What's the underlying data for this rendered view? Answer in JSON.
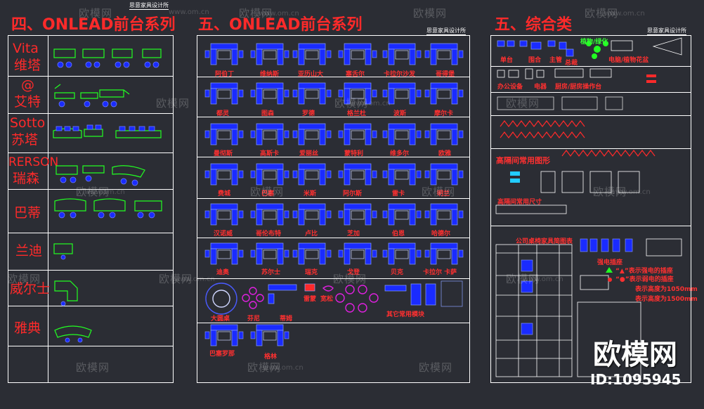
{
  "section_titles": {
    "left": "四、ONLEAD前台系列",
    "middle": "五、ONLEAD前台系列",
    "right": "五、综合类"
  },
  "stamps": {
    "left": "思意家具设计所",
    "middle": "思意家具设计所",
    "right": "思意家具设计所"
  },
  "left_rows": [
    {
      "line1": "Vita",
      "line2": "维塔"
    },
    {
      "line1": "@",
      "line2": "艾特"
    },
    {
      "line1": "Sotto",
      "line2": "苏塔"
    },
    {
      "line1": "RERSON",
      "line2": "瑞森"
    },
    {
      "line1": "",
      "line2": "巴蒂"
    },
    {
      "line1": "",
      "line2": "兰迪"
    },
    {
      "line1": "",
      "line2": "威尔士"
    },
    {
      "line1": "",
      "line2": "雅典"
    },
    {
      "line1": "",
      "line2": ""
    }
  ],
  "middle_rows": [
    {
      "labels": [
        "阿伯丁",
        "维纳斯",
        "亚历山大",
        "塞舌尔",
        "卡拉尔沙发",
        "哥得堡"
      ]
    },
    {
      "labels": [
        "都灵",
        "图森",
        "罗德",
        "格兰杜",
        "波斯",
        "摩尔卡"
      ]
    },
    {
      "labels": [
        "曼彻斯",
        "高斯卡",
        "爱丽丝",
        "蒙特利",
        "维多尔",
        "欧雅"
      ]
    },
    {
      "labels": [
        "费城",
        "巴塞",
        "米斯",
        "阿尔斯",
        "雷卡",
        "明兰"
      ]
    },
    {
      "labels": [
        "汉诺威",
        "哥伦布特",
        "卢比",
        "芝加",
        "伯恩",
        "哈德尔"
      ]
    },
    {
      "labels": [
        "迪奥",
        "苏尔士",
        "瑞克",
        "戈登",
        "贝克",
        "卡拉尔 卡萨"
      ]
    },
    {
      "labels": [
        "大圆桌",
        "芬尼",
        "蒂姆",
        "雷蒙",
        "宽松",
        "其它常用模块"
      ]
    },
    {
      "labels": [
        "巴塞罗那",
        "格林"
      ]
    }
  ],
  "right_labels": {
    "row1": [
      "单台",
      "围合",
      "主管",
      "总裁",
      "植物/绿化",
      "电脑/植物花盆"
    ],
    "row2": [
      "办公设备",
      "电器",
      "厨房/厨房操作台"
    ],
    "row4_title": "高隔间常用图形",
    "row4_sub": "高隔间常用尺寸",
    "table_title": "公司桌椅家具简图表",
    "legend_title": "强电插座",
    "legend1": "“▲”表示强电的插座",
    "legend2": "“●”表示弱电的插座",
    "legend3": "表示高度为1050mm",
    "legend4": "表示高度为1500mm"
  },
  "watermarks": {
    "brand": "欧模网",
    "site": "www.om.cn",
    "id": "ID:1095945"
  },
  "colors": {
    "background": "#2b2d34",
    "grid": "#ffffff",
    "label_red": "#ff2a2a",
    "furniture_blue": "#1a2bff",
    "furniture_green": "#22ff22",
    "magenta": "#e020e0"
  }
}
